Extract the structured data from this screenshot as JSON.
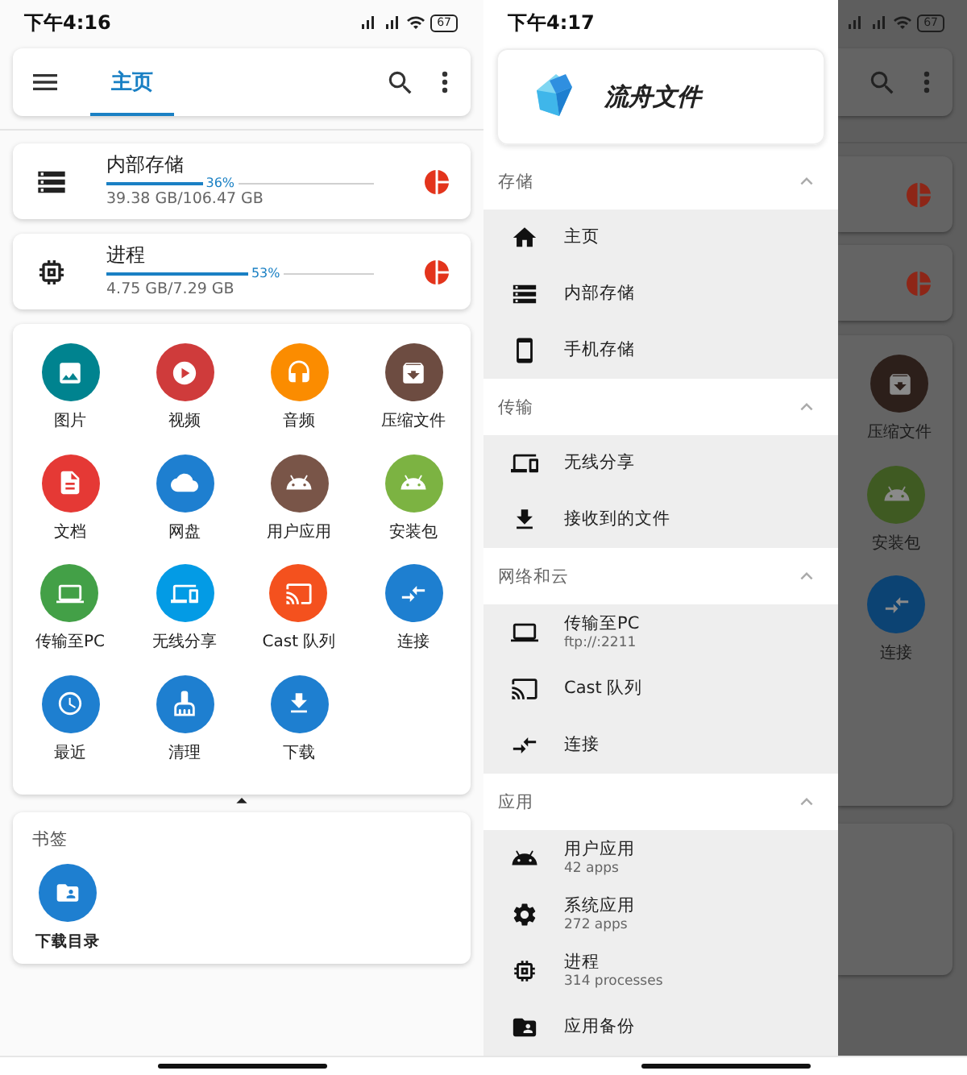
{
  "main_screen": {
    "status_bar": {
      "time": "下午4:16",
      "battery": "67"
    },
    "app_bar": {
      "tabs": [
        {
          "label": "主页",
          "selected": true
        }
      ]
    },
    "storage": [
      {
        "name": "内部存储",
        "level": 0.36,
        "percent": "36%",
        "usage": "39.38 GB/106.47 GB"
      },
      {
        "name": "进程",
        "level": 0.53,
        "percent": "53%",
        "usage": "4.75 GB/7.29 GB"
      }
    ],
    "shortcuts": [
      {
        "label": "图片",
        "color": "#00838f"
      },
      {
        "label": "视频",
        "color": "#cf3b3b"
      },
      {
        "label": "音频",
        "color": "#fb8c00"
      },
      {
        "label": "压缩文件",
        "color": "#6d4c41"
      },
      {
        "label": "文档",
        "color": "#e53935"
      },
      {
        "label": "网盘",
        "color": "#1e7fd0"
      },
      {
        "label": "用户应用",
        "color": "#795548"
      },
      {
        "label": "安装包",
        "color": "#7cb342"
      },
      {
        "label": "传输至PC",
        "color": "#43a047"
      },
      {
        "label": "无线分享",
        "color": "#039be5"
      },
      {
        "label": "Cast 队列",
        "color": "#f4511e"
      },
      {
        "label": "连接",
        "color": "#1e7fd0"
      },
      {
        "label": "最近",
        "color": "#1e7fd0"
      },
      {
        "label": "清理",
        "color": "#1e7fd0"
      },
      {
        "label": "下载",
        "color": "#1e7fd0"
      }
    ],
    "bookmarks": {
      "title": "书签",
      "items": [
        {
          "label": "下载目录",
          "color": "#1e7fd0"
        }
      ]
    }
  },
  "drawer_screen": {
    "status_bar": {
      "time": "下午4:17",
      "battery": "67"
    },
    "app_name": "流舟文件",
    "sections": [
      {
        "title": "存储",
        "expanded": true,
        "items": [
          {
            "label": "主页"
          },
          {
            "label": "内部存储"
          },
          {
            "label": "手机存储"
          }
        ]
      },
      {
        "title": "传输",
        "expanded": true,
        "items": [
          {
            "label": "无线分享"
          },
          {
            "label": "接收到的文件"
          }
        ]
      },
      {
        "title": "网络和云",
        "expanded": true,
        "items": [
          {
            "label": "传输至PC",
            "sublabel": "ftp://:2211"
          },
          {
            "label": "Cast 队列"
          },
          {
            "label": "连接"
          }
        ]
      },
      {
        "title": "应用",
        "expanded": true,
        "items": [
          {
            "label": "用户应用",
            "sublabel": "42 apps"
          },
          {
            "label": "系统应用",
            "sublabel": "272 apps"
          },
          {
            "label": "进程",
            "sublabel": "314 processes"
          },
          {
            "label": "应用备份"
          }
        ]
      }
    ],
    "backdrop_shortcuts": [
      {
        "label": "压缩文件",
        "color": "#2c1f1a"
      },
      {
        "label": "安装包",
        "color": "#3f5a22"
      },
      {
        "label": "连接",
        "color": "#0c4373"
      }
    ]
  }
}
